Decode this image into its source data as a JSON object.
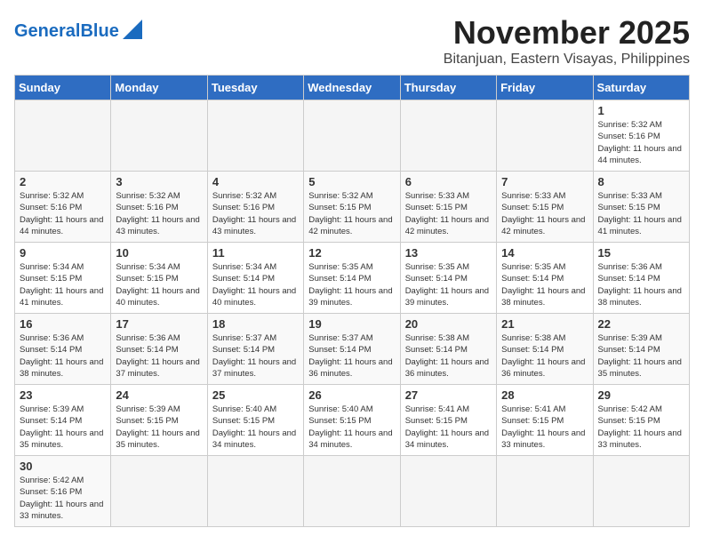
{
  "header": {
    "logo_general": "General",
    "logo_blue": "Blue",
    "month_title": "November 2025",
    "location": "Bitanjuan, Eastern Visayas, Philippines"
  },
  "weekdays": [
    "Sunday",
    "Monday",
    "Tuesday",
    "Wednesday",
    "Thursday",
    "Friday",
    "Saturday"
  ],
  "weeks": [
    [
      {
        "day": "",
        "empty": true
      },
      {
        "day": "",
        "empty": true
      },
      {
        "day": "",
        "empty": true
      },
      {
        "day": "",
        "empty": true
      },
      {
        "day": "",
        "empty": true
      },
      {
        "day": "",
        "empty": true
      },
      {
        "day": "1",
        "sunrise": "5:32 AM",
        "sunset": "5:16 PM",
        "daylight": "11 hours and 44 minutes."
      }
    ],
    [
      {
        "day": "2",
        "sunrise": "5:32 AM",
        "sunset": "5:16 PM",
        "daylight": "11 hours and 44 minutes."
      },
      {
        "day": "3",
        "sunrise": "5:32 AM",
        "sunset": "5:16 PM",
        "daylight": "11 hours and 43 minutes."
      },
      {
        "day": "4",
        "sunrise": "5:32 AM",
        "sunset": "5:16 PM",
        "daylight": "11 hours and 43 minutes."
      },
      {
        "day": "5",
        "sunrise": "5:32 AM",
        "sunset": "5:15 PM",
        "daylight": "11 hours and 42 minutes."
      },
      {
        "day": "6",
        "sunrise": "5:33 AM",
        "sunset": "5:15 PM",
        "daylight": "11 hours and 42 minutes."
      },
      {
        "day": "7",
        "sunrise": "5:33 AM",
        "sunset": "5:15 PM",
        "daylight": "11 hours and 42 minutes."
      },
      {
        "day": "8",
        "sunrise": "5:33 AM",
        "sunset": "5:15 PM",
        "daylight": "11 hours and 41 minutes."
      }
    ],
    [
      {
        "day": "9",
        "sunrise": "5:34 AM",
        "sunset": "5:15 PM",
        "daylight": "11 hours and 41 minutes."
      },
      {
        "day": "10",
        "sunrise": "5:34 AM",
        "sunset": "5:15 PM",
        "daylight": "11 hours and 40 minutes."
      },
      {
        "day": "11",
        "sunrise": "5:34 AM",
        "sunset": "5:14 PM",
        "daylight": "11 hours and 40 minutes."
      },
      {
        "day": "12",
        "sunrise": "5:35 AM",
        "sunset": "5:14 PM",
        "daylight": "11 hours and 39 minutes."
      },
      {
        "day": "13",
        "sunrise": "5:35 AM",
        "sunset": "5:14 PM",
        "daylight": "11 hours and 39 minutes."
      },
      {
        "day": "14",
        "sunrise": "5:35 AM",
        "sunset": "5:14 PM",
        "daylight": "11 hours and 38 minutes."
      },
      {
        "day": "15",
        "sunrise": "5:36 AM",
        "sunset": "5:14 PM",
        "daylight": "11 hours and 38 minutes."
      }
    ],
    [
      {
        "day": "16",
        "sunrise": "5:36 AM",
        "sunset": "5:14 PM",
        "daylight": "11 hours and 38 minutes."
      },
      {
        "day": "17",
        "sunrise": "5:36 AM",
        "sunset": "5:14 PM",
        "daylight": "11 hours and 37 minutes."
      },
      {
        "day": "18",
        "sunrise": "5:37 AM",
        "sunset": "5:14 PM",
        "daylight": "11 hours and 37 minutes."
      },
      {
        "day": "19",
        "sunrise": "5:37 AM",
        "sunset": "5:14 PM",
        "daylight": "11 hours and 36 minutes."
      },
      {
        "day": "20",
        "sunrise": "5:38 AM",
        "sunset": "5:14 PM",
        "daylight": "11 hours and 36 minutes."
      },
      {
        "day": "21",
        "sunrise": "5:38 AM",
        "sunset": "5:14 PM",
        "daylight": "11 hours and 36 minutes."
      },
      {
        "day": "22",
        "sunrise": "5:39 AM",
        "sunset": "5:14 PM",
        "daylight": "11 hours and 35 minutes."
      }
    ],
    [
      {
        "day": "23",
        "sunrise": "5:39 AM",
        "sunset": "5:14 PM",
        "daylight": "11 hours and 35 minutes."
      },
      {
        "day": "24",
        "sunrise": "5:39 AM",
        "sunset": "5:15 PM",
        "daylight": "11 hours and 35 minutes."
      },
      {
        "day": "25",
        "sunrise": "5:40 AM",
        "sunset": "5:15 PM",
        "daylight": "11 hours and 34 minutes."
      },
      {
        "day": "26",
        "sunrise": "5:40 AM",
        "sunset": "5:15 PM",
        "daylight": "11 hours and 34 minutes."
      },
      {
        "day": "27",
        "sunrise": "5:41 AM",
        "sunset": "5:15 PM",
        "daylight": "11 hours and 34 minutes."
      },
      {
        "day": "28",
        "sunrise": "5:41 AM",
        "sunset": "5:15 PM",
        "daylight": "11 hours and 33 minutes."
      },
      {
        "day": "29",
        "sunrise": "5:42 AM",
        "sunset": "5:15 PM",
        "daylight": "11 hours and 33 minutes."
      }
    ],
    [
      {
        "day": "30",
        "sunrise": "5:42 AM",
        "sunset": "5:16 PM",
        "daylight": "11 hours and 33 minutes."
      },
      {
        "day": "",
        "empty": true
      },
      {
        "day": "",
        "empty": true
      },
      {
        "day": "",
        "empty": true
      },
      {
        "day": "",
        "empty": true
      },
      {
        "day": "",
        "empty": true
      },
      {
        "day": "",
        "empty": true
      }
    ]
  ],
  "labels": {
    "sunrise": "Sunrise:",
    "sunset": "Sunset:",
    "daylight": "Daylight:"
  }
}
